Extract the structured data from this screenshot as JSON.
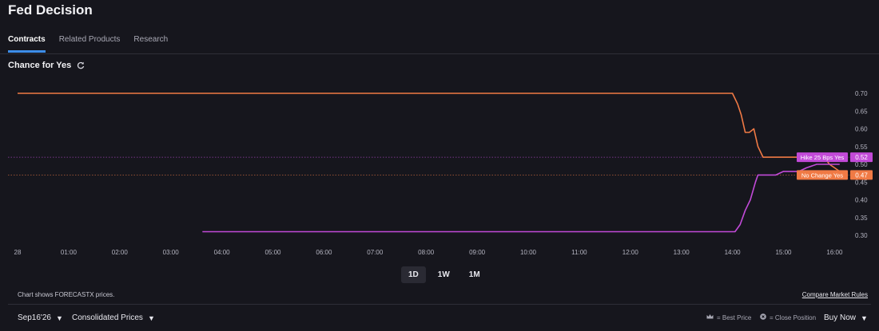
{
  "header": {
    "title": "Fed Decision"
  },
  "tabs": [
    {
      "label": "Contracts"
    },
    {
      "label": "Related Products"
    },
    {
      "label": "Research"
    }
  ],
  "section": {
    "title": "Chance for Yes"
  },
  "chart_data": {
    "type": "line",
    "x_axis": {
      "ticks": [
        "28",
        "01:00",
        "02:00",
        "03:00",
        "04:00",
        "05:00",
        "06:00",
        "07:00",
        "08:00",
        "09:00",
        "10:00",
        "11:00",
        "12:00",
        "13:00",
        "14:00",
        "15:00",
        "16:00"
      ]
    },
    "y_axis": {
      "ticks": [
        "0.70",
        "0.65",
        "0.60",
        "0.55",
        "0.50",
        "0.45",
        "0.40",
        "0.35",
        "0.30"
      ],
      "ylim": [
        0.3,
        0.7
      ]
    },
    "series": [
      {
        "name": "No Change Yes",
        "color": "#f07a45",
        "last_value": "0.47",
        "points": [
          [
            0,
            0.7
          ],
          [
            14.0,
            0.7
          ],
          [
            14.1,
            0.67
          ],
          [
            14.17,
            0.64
          ],
          [
            14.25,
            0.59
          ],
          [
            14.33,
            0.59
          ],
          [
            14.42,
            0.6
          ],
          [
            14.5,
            0.55
          ],
          [
            14.6,
            0.52
          ],
          [
            15.8,
            0.52
          ],
          [
            15.9,
            0.5
          ],
          [
            16.0,
            0.49
          ],
          [
            16.1,
            0.48
          ]
        ]
      },
      {
        "name": "Hike 25 Bps Yes",
        "color": "#c24ad8",
        "last_value": "0.52",
        "points": [
          [
            3.62,
            0.31
          ],
          [
            14.05,
            0.31
          ],
          [
            14.15,
            0.33
          ],
          [
            14.25,
            0.37
          ],
          [
            14.35,
            0.4
          ],
          [
            14.45,
            0.45
          ],
          [
            14.5,
            0.47
          ],
          [
            14.85,
            0.47
          ],
          [
            15.0,
            0.48
          ],
          [
            15.3,
            0.48
          ],
          [
            15.45,
            0.49
          ],
          [
            15.65,
            0.5
          ],
          [
            16.1,
            0.5
          ]
        ]
      }
    ]
  },
  "range_buttons": [
    {
      "label": "1D"
    },
    {
      "label": "1W"
    },
    {
      "label": "1M"
    }
  ],
  "footer": {
    "note": "Chart shows FORECASTX prices.",
    "compare_link": "Compare Market Rules",
    "date_select": "Sep16'26",
    "price_select": "Consolidated Prices",
    "best_price": "= Best Price",
    "close_position": "= Close Position",
    "buy_select": "Buy Now"
  }
}
